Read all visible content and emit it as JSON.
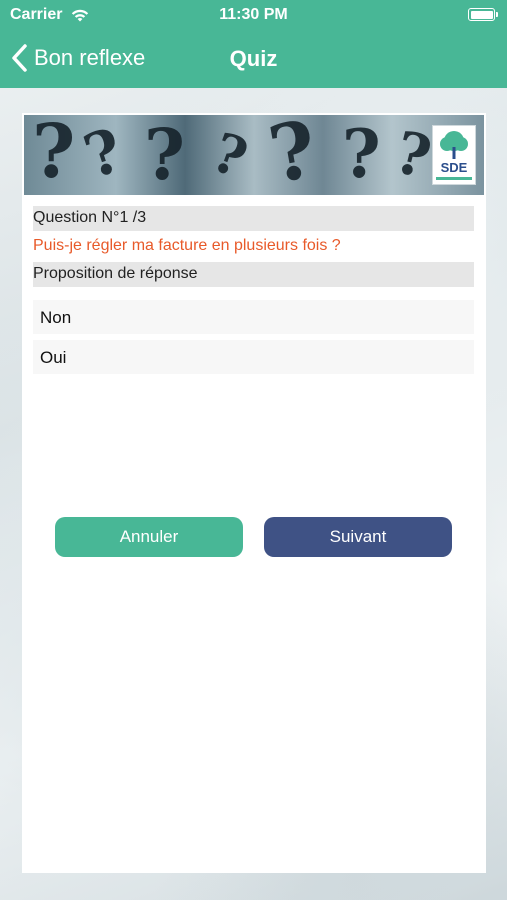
{
  "status_bar": {
    "carrier": "Carrier",
    "time": "11:30 PM"
  },
  "nav": {
    "back_label": "Bon reflexe",
    "title": "Quiz"
  },
  "banner": {
    "logo_text": "SDE"
  },
  "quiz": {
    "question_number": "Question N°1 /3",
    "question": "Puis-je régler ma facture en plusieurs fois ?",
    "proposals_header": "Proposition de réponse",
    "options": [
      "Non",
      "Oui"
    ]
  },
  "buttons": {
    "cancel": "Annuler",
    "next": "Suivant"
  },
  "colors": {
    "accent": "#48b796",
    "primary_button": "#3f5285",
    "question_text": "#e85a2a"
  }
}
